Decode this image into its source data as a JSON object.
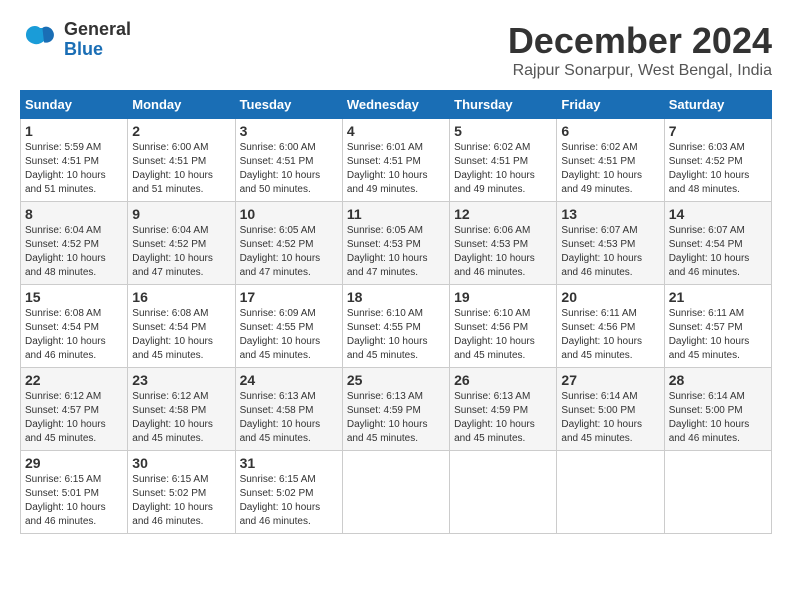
{
  "header": {
    "logo": {
      "general": "General",
      "blue": "Blue"
    },
    "title": "December 2024",
    "location": "Rajpur Sonarpur, West Bengal, India"
  },
  "days_of_week": [
    "Sunday",
    "Monday",
    "Tuesday",
    "Wednesday",
    "Thursday",
    "Friday",
    "Saturday"
  ],
  "weeks": [
    [
      {
        "day": "1",
        "sunrise": "Sunrise: 5:59 AM",
        "sunset": "Sunset: 4:51 PM",
        "daylight": "Daylight: 10 hours and 51 minutes."
      },
      {
        "day": "2",
        "sunrise": "Sunrise: 6:00 AM",
        "sunset": "Sunset: 4:51 PM",
        "daylight": "Daylight: 10 hours and 51 minutes."
      },
      {
        "day": "3",
        "sunrise": "Sunrise: 6:00 AM",
        "sunset": "Sunset: 4:51 PM",
        "daylight": "Daylight: 10 hours and 50 minutes."
      },
      {
        "day": "4",
        "sunrise": "Sunrise: 6:01 AM",
        "sunset": "Sunset: 4:51 PM",
        "daylight": "Daylight: 10 hours and 49 minutes."
      },
      {
        "day": "5",
        "sunrise": "Sunrise: 6:02 AM",
        "sunset": "Sunset: 4:51 PM",
        "daylight": "Daylight: 10 hours and 49 minutes."
      },
      {
        "day": "6",
        "sunrise": "Sunrise: 6:02 AM",
        "sunset": "Sunset: 4:51 PM",
        "daylight": "Daylight: 10 hours and 49 minutes."
      },
      {
        "day": "7",
        "sunrise": "Sunrise: 6:03 AM",
        "sunset": "Sunset: 4:52 PM",
        "daylight": "Daylight: 10 hours and 48 minutes."
      }
    ],
    [
      {
        "day": "8",
        "sunrise": "Sunrise: 6:04 AM",
        "sunset": "Sunset: 4:52 PM",
        "daylight": "Daylight: 10 hours and 48 minutes."
      },
      {
        "day": "9",
        "sunrise": "Sunrise: 6:04 AM",
        "sunset": "Sunset: 4:52 PM",
        "daylight": "Daylight: 10 hours and 47 minutes."
      },
      {
        "day": "10",
        "sunrise": "Sunrise: 6:05 AM",
        "sunset": "Sunset: 4:52 PM",
        "daylight": "Daylight: 10 hours and 47 minutes."
      },
      {
        "day": "11",
        "sunrise": "Sunrise: 6:05 AM",
        "sunset": "Sunset: 4:53 PM",
        "daylight": "Daylight: 10 hours and 47 minutes."
      },
      {
        "day": "12",
        "sunrise": "Sunrise: 6:06 AM",
        "sunset": "Sunset: 4:53 PM",
        "daylight": "Daylight: 10 hours and 46 minutes."
      },
      {
        "day": "13",
        "sunrise": "Sunrise: 6:07 AM",
        "sunset": "Sunset: 4:53 PM",
        "daylight": "Daylight: 10 hours and 46 minutes."
      },
      {
        "day": "14",
        "sunrise": "Sunrise: 6:07 AM",
        "sunset": "Sunset: 4:54 PM",
        "daylight": "Daylight: 10 hours and 46 minutes."
      }
    ],
    [
      {
        "day": "15",
        "sunrise": "Sunrise: 6:08 AM",
        "sunset": "Sunset: 4:54 PM",
        "daylight": "Daylight: 10 hours and 46 minutes."
      },
      {
        "day": "16",
        "sunrise": "Sunrise: 6:08 AM",
        "sunset": "Sunset: 4:54 PM",
        "daylight": "Daylight: 10 hours and 45 minutes."
      },
      {
        "day": "17",
        "sunrise": "Sunrise: 6:09 AM",
        "sunset": "Sunset: 4:55 PM",
        "daylight": "Daylight: 10 hours and 45 minutes."
      },
      {
        "day": "18",
        "sunrise": "Sunrise: 6:10 AM",
        "sunset": "Sunset: 4:55 PM",
        "daylight": "Daylight: 10 hours and 45 minutes."
      },
      {
        "day": "19",
        "sunrise": "Sunrise: 6:10 AM",
        "sunset": "Sunset: 4:56 PM",
        "daylight": "Daylight: 10 hours and 45 minutes."
      },
      {
        "day": "20",
        "sunrise": "Sunrise: 6:11 AM",
        "sunset": "Sunset: 4:56 PM",
        "daylight": "Daylight: 10 hours and 45 minutes."
      },
      {
        "day": "21",
        "sunrise": "Sunrise: 6:11 AM",
        "sunset": "Sunset: 4:57 PM",
        "daylight": "Daylight: 10 hours and 45 minutes."
      }
    ],
    [
      {
        "day": "22",
        "sunrise": "Sunrise: 6:12 AM",
        "sunset": "Sunset: 4:57 PM",
        "daylight": "Daylight: 10 hours and 45 minutes."
      },
      {
        "day": "23",
        "sunrise": "Sunrise: 6:12 AM",
        "sunset": "Sunset: 4:58 PM",
        "daylight": "Daylight: 10 hours and 45 minutes."
      },
      {
        "day": "24",
        "sunrise": "Sunrise: 6:13 AM",
        "sunset": "Sunset: 4:58 PM",
        "daylight": "Daylight: 10 hours and 45 minutes."
      },
      {
        "day": "25",
        "sunrise": "Sunrise: 6:13 AM",
        "sunset": "Sunset: 4:59 PM",
        "daylight": "Daylight: 10 hours and 45 minutes."
      },
      {
        "day": "26",
        "sunrise": "Sunrise: 6:13 AM",
        "sunset": "Sunset: 4:59 PM",
        "daylight": "Daylight: 10 hours and 45 minutes."
      },
      {
        "day": "27",
        "sunrise": "Sunrise: 6:14 AM",
        "sunset": "Sunset: 5:00 PM",
        "daylight": "Daylight: 10 hours and 45 minutes."
      },
      {
        "day": "28",
        "sunrise": "Sunrise: 6:14 AM",
        "sunset": "Sunset: 5:00 PM",
        "daylight": "Daylight: 10 hours and 46 minutes."
      }
    ],
    [
      {
        "day": "29",
        "sunrise": "Sunrise: 6:15 AM",
        "sunset": "Sunset: 5:01 PM",
        "daylight": "Daylight: 10 hours and 46 minutes."
      },
      {
        "day": "30",
        "sunrise": "Sunrise: 6:15 AM",
        "sunset": "Sunset: 5:02 PM",
        "daylight": "Daylight: 10 hours and 46 minutes."
      },
      {
        "day": "31",
        "sunrise": "Sunrise: 6:15 AM",
        "sunset": "Sunset: 5:02 PM",
        "daylight": "Daylight: 10 hours and 46 minutes."
      },
      null,
      null,
      null,
      null
    ]
  ]
}
